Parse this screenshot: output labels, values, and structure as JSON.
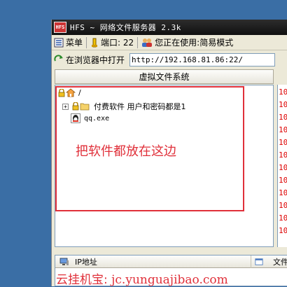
{
  "window": {
    "title": "HFS ~ 网络文件服务器 2.3k",
    "logo_text": "HFS"
  },
  "toolbar": {
    "menu_label": "菜单",
    "port_label": "端口: 22",
    "mode_label": "您正在使用:简易模式"
  },
  "address_bar": {
    "open_in_browser_label": "在浏览器中打开",
    "url": "http://192.168.81.86:22/"
  },
  "vfs": {
    "header": "虚拟文件系统",
    "root_label": "/",
    "items": [
      {
        "label": "付费软件 用户和密码都是1",
        "type": "folder"
      },
      {
        "label": "qq.exe",
        "type": "file"
      }
    ]
  },
  "annotation": {
    "text": "把软件都放在这边",
    "color": "#e0303a"
  },
  "log": {
    "lines": [
      "10",
      "10",
      "10",
      "10",
      "10",
      "10",
      "10",
      "10",
      "10",
      "10",
      "10",
      "10"
    ]
  },
  "connections": {
    "col_ip": "IP地址",
    "col_file": "文件"
  },
  "watermark": {
    "prefix": "云挂机宝:",
    "url": "jc.yunguajibao.com"
  },
  "colors": {
    "accent_red": "#e0303a",
    "log_red": "#dd0000"
  }
}
